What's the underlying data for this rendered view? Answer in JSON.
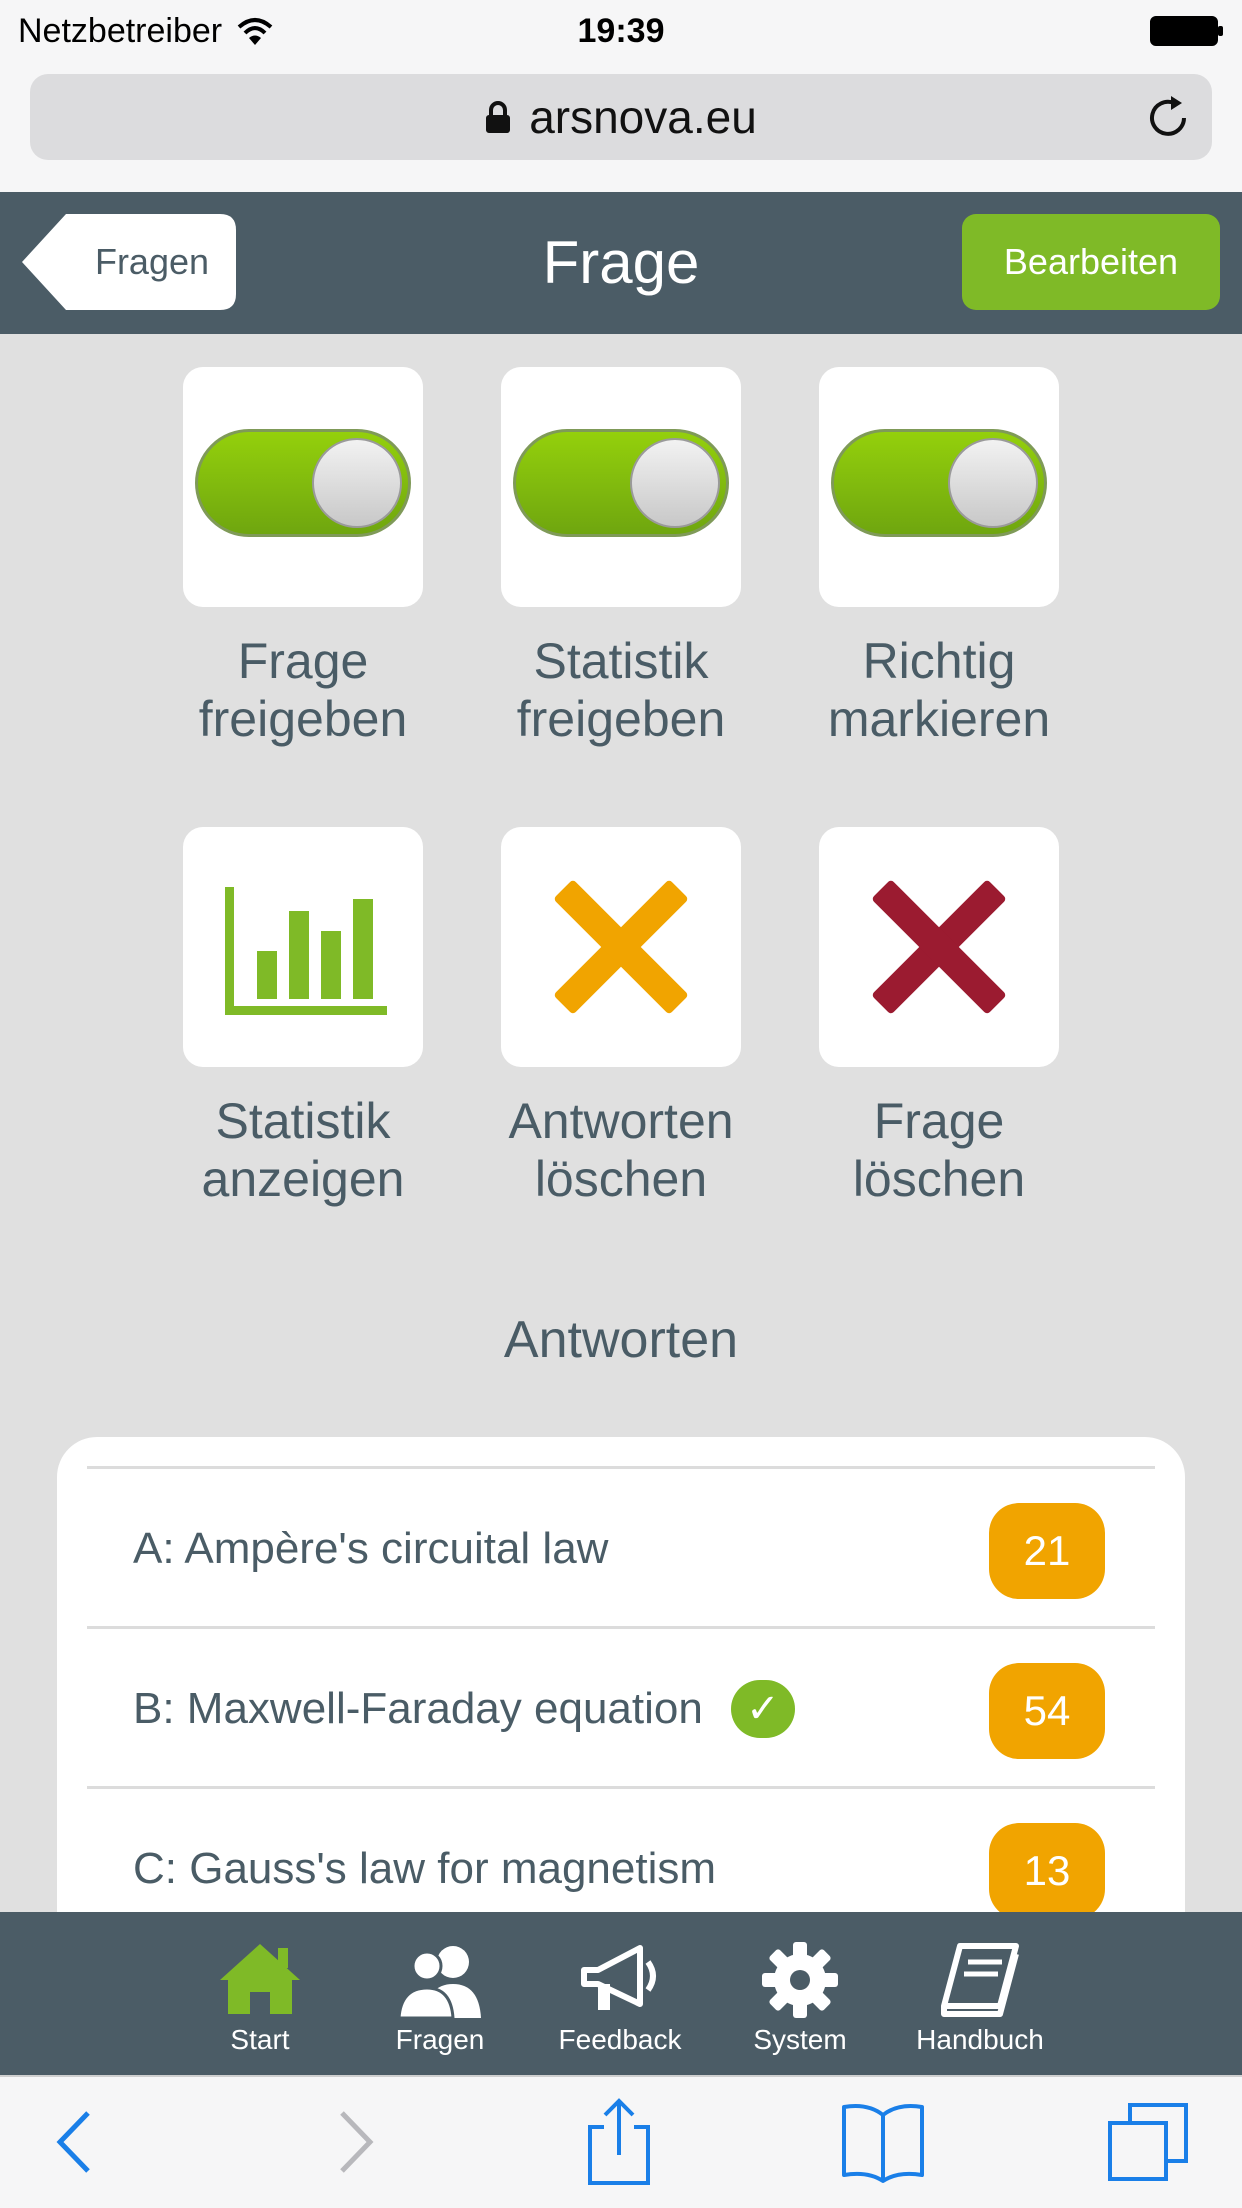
{
  "status": {
    "carrier": "Netzbetreiber",
    "time": "19:39"
  },
  "browser": {
    "url": "arsnova.eu"
  },
  "header": {
    "back_label": "Fragen",
    "title": "Frage",
    "edit_label": "Bearbeiten"
  },
  "tiles": [
    {
      "label_line1": "Frage",
      "label_line2": "freigeben",
      "state": "on"
    },
    {
      "label_line1": "Statistik",
      "label_line2": "freigeben",
      "state": "on"
    },
    {
      "label_line1": "Richtig",
      "label_line2": "markieren",
      "state": "on"
    },
    {
      "label_line1": "Statistik",
      "label_line2": "anzeigen",
      "icon": "bar-chart-icon"
    },
    {
      "label_line1": "Antworten",
      "label_line2": "löschen",
      "icon": "delete-answers-icon"
    },
    {
      "label_line1": "Frage",
      "label_line2": "löschen",
      "icon": "delete-question-icon"
    }
  ],
  "answers_title": "Antworten",
  "answers": [
    {
      "text": "A: Ampère's circuital law",
      "count": "21",
      "correct": false
    },
    {
      "text": "B: Maxwell-Faraday equation",
      "count": "54",
      "correct": true,
      "check_symbol": "✓"
    },
    {
      "text": "C: Gauss's law for magnetism",
      "count": "13",
      "correct": false
    }
  ],
  "tabbar": [
    {
      "label": "Start",
      "icon": "home-icon",
      "active": true
    },
    {
      "label": "Fragen",
      "icon": "users-icon"
    },
    {
      "label": "Feedback",
      "icon": "megaphone-icon"
    },
    {
      "label": "System",
      "icon": "gear-icon"
    },
    {
      "label": "Handbuch",
      "icon": "book-icon"
    }
  ],
  "colors": {
    "header": "#4b5c66",
    "accent_green": "#7fba27",
    "count_orange": "#f1a400",
    "delete_red": "#9b1b30",
    "text": "#4a5c66"
  }
}
